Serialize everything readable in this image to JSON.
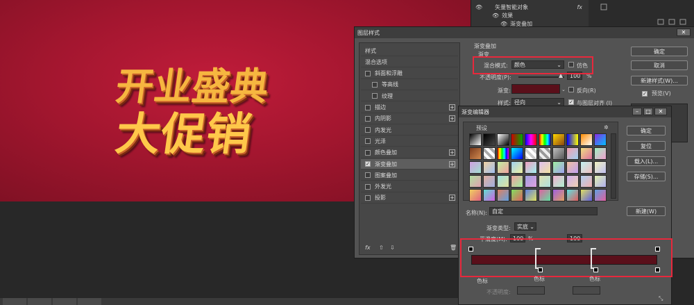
{
  "canvas": {
    "line1": "开业盛典",
    "line2": "大促销"
  },
  "layers": {
    "row1": "矢量智能对象",
    "row2": "效果",
    "row3": "渐变叠加",
    "fx": "fx"
  },
  "layer_style": {
    "title": "图层样式",
    "left_items": [
      {
        "label": "样式",
        "check": false,
        "plus": false,
        "indent": false,
        "selected": false
      },
      {
        "label": "混合选项",
        "check": false,
        "plus": false,
        "indent": false,
        "selected": false
      },
      {
        "label": "斜面和浮雕",
        "check": true,
        "checked": false,
        "plus": false,
        "indent": false,
        "selected": false
      },
      {
        "label": "等高线",
        "check": true,
        "checked": false,
        "plus": false,
        "indent": true,
        "selected": false
      },
      {
        "label": "纹理",
        "check": true,
        "checked": false,
        "plus": false,
        "indent": true,
        "selected": false
      },
      {
        "label": "描边",
        "check": true,
        "checked": false,
        "plus": true,
        "indent": false,
        "selected": false
      },
      {
        "label": "内阴影",
        "check": true,
        "checked": false,
        "plus": true,
        "indent": false,
        "selected": false
      },
      {
        "label": "内发光",
        "check": true,
        "checked": false,
        "plus": false,
        "indent": false,
        "selected": false
      },
      {
        "label": "光泽",
        "check": true,
        "checked": false,
        "plus": false,
        "indent": false,
        "selected": false
      },
      {
        "label": "颜色叠加",
        "check": true,
        "checked": false,
        "plus": true,
        "indent": false,
        "selected": false
      },
      {
        "label": "渐变叠加",
        "check": true,
        "checked": true,
        "plus": true,
        "indent": false,
        "selected": true
      },
      {
        "label": "图案叠加",
        "check": true,
        "checked": false,
        "plus": false,
        "indent": false,
        "selected": false
      },
      {
        "label": "外发光",
        "check": true,
        "checked": false,
        "plus": false,
        "indent": false,
        "selected": false
      },
      {
        "label": "投影",
        "check": true,
        "checked": false,
        "plus": true,
        "indent": false,
        "selected": false
      }
    ],
    "fx_label": "fx",
    "section_title": "渐变叠加",
    "subsection": "渐变",
    "blend_mode_label": "混合模式:",
    "blend_mode_value": "颜色",
    "dither_label": "仿色",
    "opacity_label": "不透明度(P):",
    "opacity_value": "100",
    "opacity_unit": "%",
    "gradient_label": "渐变:",
    "reverse_label": "反向(R)",
    "style_label": "样式:",
    "style_value": "径向",
    "align_label": "与图层对齐 (I)",
    "buttons": {
      "ok": "确定",
      "cancel": "取消",
      "new_style": "新建样式(W)...",
      "preview": "预览(V)"
    },
    "gradient_color": "#5a0f1a"
  },
  "gradient_editor": {
    "title": "渐变编辑器",
    "presets_label": "预设",
    "buttons": {
      "ok": "确定",
      "reset": "复位",
      "load": "载入(L)...",
      "save": "存储(S)...",
      "new": "新建(W)"
    },
    "name_label": "名称(N):",
    "name_value": "自定",
    "type_label": "渐变类型:",
    "type_value": "实底",
    "smoothness_label": "平滑度(M):",
    "smoothness_value": "100",
    "smoothness_unit": "%",
    "opacity_field_value": "100",
    "stop_label_1": "色标",
    "stop_label_2": "色标",
    "stop_label_3": "色标",
    "opacity_bottom_label": "不透明度:",
    "bar_color": "#5a0f1a"
  },
  "colors": {
    "highlight": "#e8283c",
    "canvas_red": "#a3162f"
  }
}
